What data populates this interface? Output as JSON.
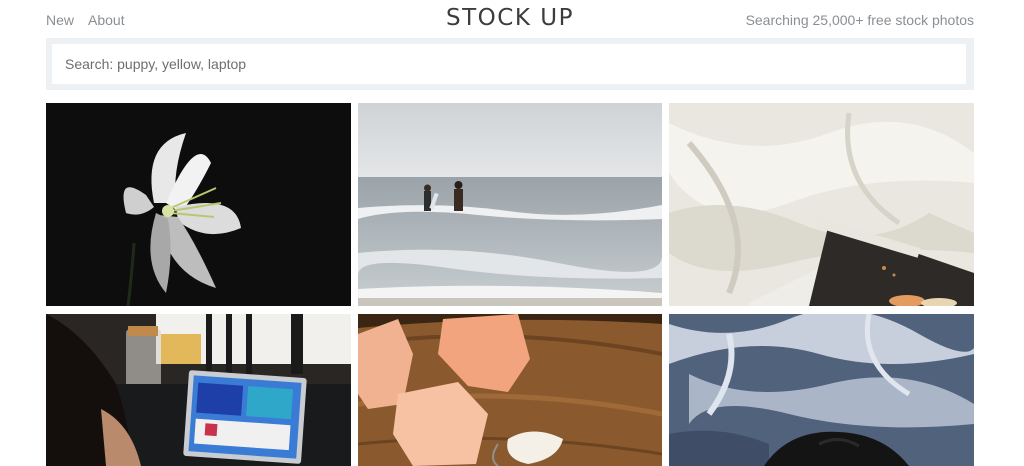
{
  "header": {
    "nav": [
      {
        "label": "New"
      },
      {
        "label": "About"
      }
    ],
    "logo": "STOCK UP",
    "tagline": "Searching 25,000+ free stock photos"
  },
  "search": {
    "placeholder": "Search: puppy, yellow, laptop",
    "value": ""
  },
  "photos": [
    {
      "subject": "white-lily-on-black"
    },
    {
      "subject": "surfers-walking-into-ocean"
    },
    {
      "subject": "white-linen-with-tray"
    },
    {
      "subject": "person-using-laptop"
    },
    {
      "subject": "pink-salt-crystals-on-wood"
    },
    {
      "subject": "blue-rug-with-dog"
    }
  ]
}
